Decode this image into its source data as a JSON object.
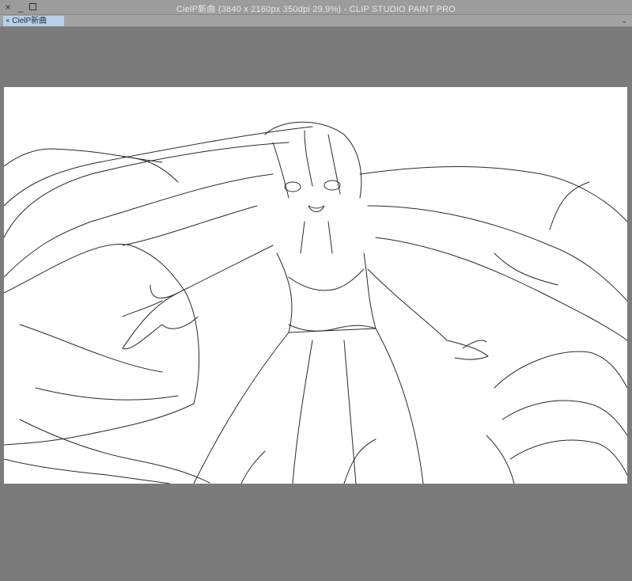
{
  "window": {
    "title": "CielP新曲 (3840 x 2160px 350dpi 29.9%)  - CLIP STUDIO PAINT PRO",
    "controls": {
      "close": "×",
      "minimize": "_",
      "maximize": "□"
    }
  },
  "tabs": [
    {
      "label": "CielP新曲",
      "close": "×",
      "active": true
    }
  ],
  "tab_menu_glyph": "⌄",
  "colors": {
    "workspace": "#7b7b7b",
    "titlebar": "#9c9c9c",
    "active_tab": "#b9d1e8",
    "canvas": "#ffffff",
    "lineart": "#2a2a2a"
  },
  "canvas": {
    "content": "line-art illustration"
  }
}
